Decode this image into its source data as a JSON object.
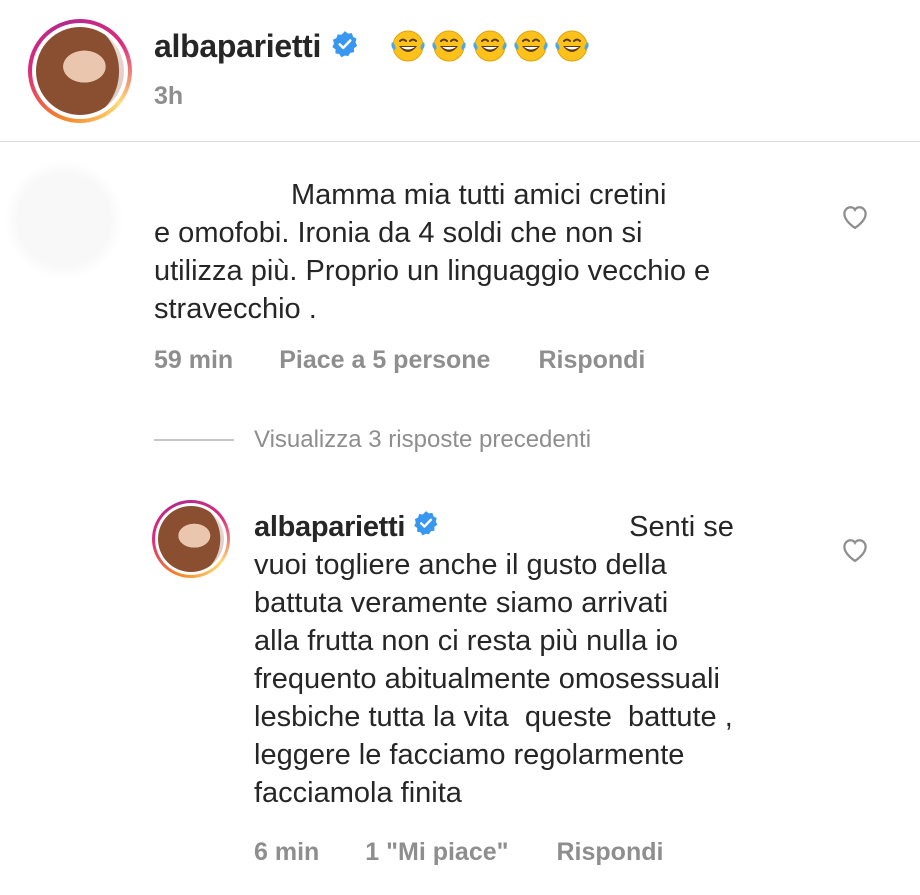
{
  "post": {
    "username": "albaparietti",
    "verified": true,
    "emoji_count": 5,
    "emoji": "laughing-with-tears",
    "time": "3h"
  },
  "comment": {
    "text_lines": [
      "Mamma mia tutti amici cretini",
      "e omofobi. Ironia da 4 soldi che non si",
      "utilizza più. Proprio un linguaggio vecchio e",
      "stravecchio ."
    ],
    "time": "59 min",
    "likes": "Piace a 5 persone",
    "reply": "Rispondi"
  },
  "view_replies": "Visualizza 3 risposte precedenti",
  "reply": {
    "username": "albaparietti",
    "verified": true,
    "text_first": "Senti se",
    "text_lines": [
      "vuoi togliere anche il gusto della",
      "battuta veramente siamo arrivati",
      "alla frutta non ci resta più nulla io",
      "frequento abitualmente omosessuali",
      "lesbiche tutta la vita  queste  battute ,",
      "leggere le facciamo regolarmente",
      "facciamola finita"
    ],
    "time": "6 min",
    "likes": "1 \"Mi piace\"",
    "reply": "Rispondi"
  },
  "colors": {
    "text": "#262626",
    "secondary": "#8e8e8e",
    "verified": "#3897f0",
    "divider": "#dbdbdb"
  }
}
